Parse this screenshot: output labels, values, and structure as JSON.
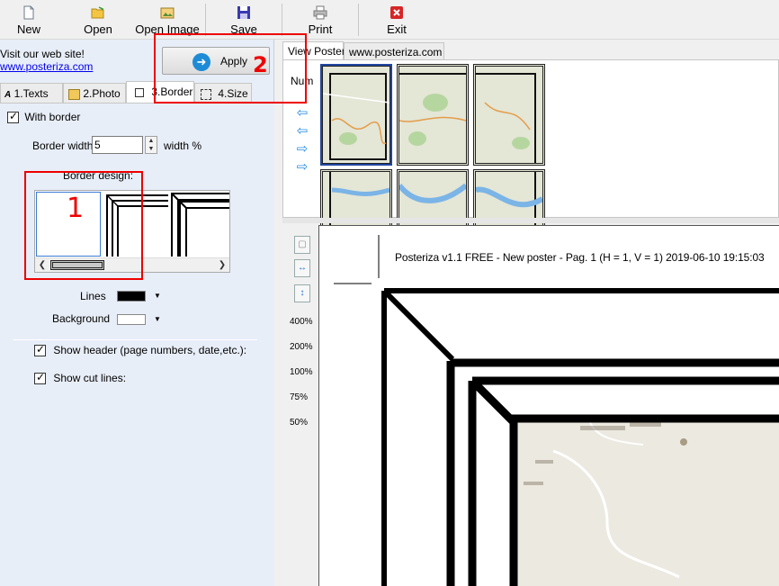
{
  "toolbar": {
    "new_label": "New",
    "open_label": "Open",
    "open_image_label": "Open Image",
    "save_label": "Save",
    "print_label": "Print",
    "exit_label": "Exit"
  },
  "left": {
    "visit_text": "Visit our web site!",
    "website_link": "www.posteriza.com",
    "apply_label": "Apply",
    "tabs": [
      {
        "label": "1.Texts"
      },
      {
        "label": "2.Photo"
      },
      {
        "label": "3.Border"
      },
      {
        "label": "4.Size"
      }
    ],
    "border": {
      "with_border_label": "With border",
      "with_border_checked": true,
      "width_label": "Border width",
      "width_value": "5",
      "width_unit": "width %",
      "design_label": "Border design:",
      "lines_label": "Lines",
      "lines_color": "#000000",
      "background_label": "Background",
      "background_color": "#ffffff",
      "show_header_label": "Show header (page numbers, date,etc.):",
      "show_header_checked": true,
      "show_cut_lines_label": "Show cut lines:",
      "show_cut_lines_checked": true
    }
  },
  "right": {
    "tabs": [
      {
        "label": "View Poster"
      },
      {
        "label": "www.posteriza.com"
      }
    ],
    "num_label": "Num",
    "zoom_levels": [
      "400%",
      "200%",
      "100%",
      "75%",
      "50%"
    ],
    "page_header": "Posteriza v1.1 FREE - New poster - Pag. 1 (H = 1, V = 1) 2019-06-10 19:15:03"
  },
  "annotations": {
    "mark_1": "1",
    "mark_2": "2",
    "color": "#e00000"
  }
}
